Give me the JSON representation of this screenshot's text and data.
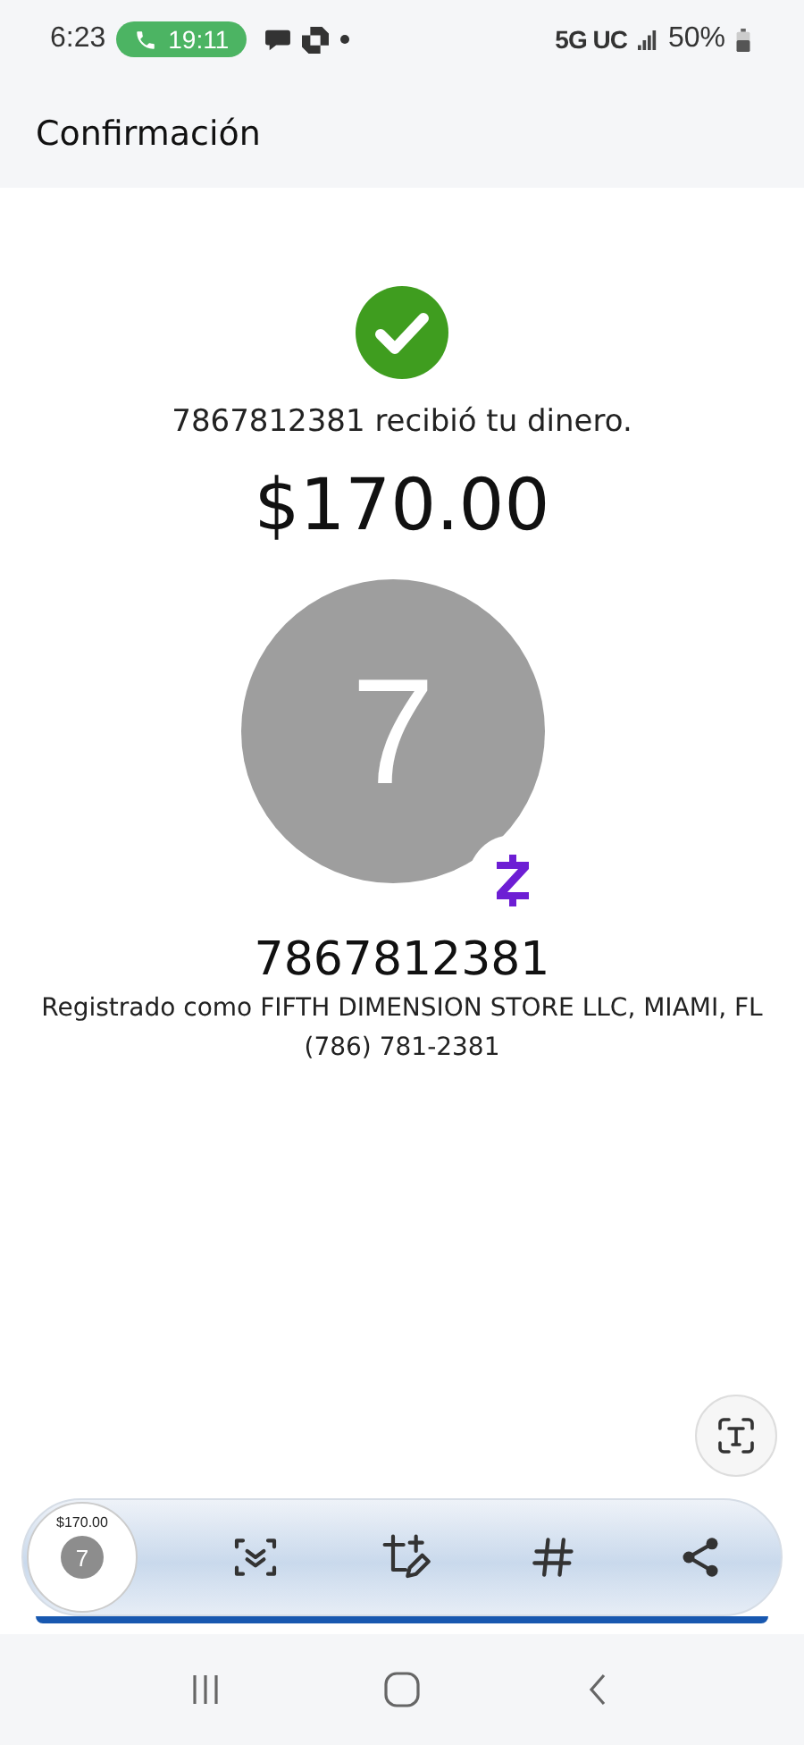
{
  "status_bar": {
    "time": "6:23",
    "call_duration": "19:11",
    "network": "5G UC",
    "battery": "50%"
  },
  "header": {
    "title": "Confirmación"
  },
  "confirmation": {
    "message": "7867812381 recibió tu dinero.",
    "amount": "$170.00"
  },
  "recipient": {
    "avatar_initial": "7",
    "name": "7867812381",
    "registered_as": "Registrado como FIFTH DIMENSION STORE LLC, MIAMI, FL",
    "phone": "(786) 781-2381"
  },
  "screenshot_toolbar": {
    "thumbnail": {
      "amount": "$170.00",
      "initial": "7"
    }
  }
}
